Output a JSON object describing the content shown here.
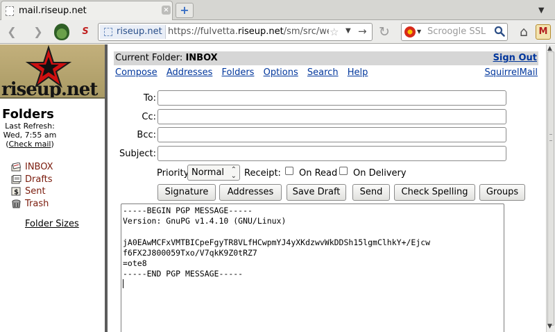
{
  "browser": {
    "tab_title": "mail.riseup.net",
    "url_site": "riseup.net",
    "url_prefix": "https://fulvetta.",
    "url_domain": "riseup.net",
    "url_path": "/sm/src/we",
    "search_placeholder": "Scroogle SSL",
    "icons": {
      "back": "back-arrow-icon",
      "forward": "forward-arrow-icon",
      "tor": "tor-onion-icon",
      "reload": "reload-icon",
      "home": "home-icon",
      "bookmark": "star-icon",
      "search": "magnifier-icon"
    }
  },
  "sidebar": {
    "logo_text": "riseup.net",
    "title": "Folders",
    "last_refresh_label": "Last Refresh:",
    "last_refresh_value": "Wed, 7:55 am",
    "check_mail_open": "(",
    "check_mail": "Check mail",
    "check_mail_close": ")",
    "folders": [
      {
        "label": "INBOX",
        "icon": "inbox-icon"
      },
      {
        "label": "Drafts",
        "icon": "drafts-icon"
      },
      {
        "label": "Sent",
        "icon": "sent-icon"
      },
      {
        "label": "Trash",
        "icon": "trash-icon"
      }
    ],
    "folder_sizes": "Folder Sizes"
  },
  "header": {
    "current_folder_label": "Current Folder:",
    "current_folder": "INBOX",
    "sign_out": "Sign Out",
    "menu": [
      "Compose",
      "Addresses",
      "Folders",
      "Options",
      "Search",
      "Help"
    ],
    "brand_link": "SquirrelMail"
  },
  "compose": {
    "to_label": "To:",
    "cc_label": "Cc:",
    "bcc_label": "Bcc:",
    "subject_label": "Subject:",
    "to": "",
    "cc": "",
    "bcc": "",
    "subject": "",
    "priority_label": "Priority",
    "priority_value": "Normal",
    "receipt_label": "Receipt:",
    "on_read_label": "On Read",
    "on_delivery_label": "On Delivery",
    "buttons": {
      "signature": "Signature",
      "addresses": "Addresses",
      "save_draft": "Save Draft",
      "send": "Send",
      "check_spelling": "Check Spelling",
      "groups": "Groups"
    },
    "body": "-----BEGIN PGP MESSAGE-----\nVersion: GnuPG v1.4.10 (GNU/Linux)\n\njA0EAwMCFxVMTBICpeFgyTR8VLfHCwpmYJ4yXKdzwvWkDDSh15lgmClhkY+/Ejcw\nf6FX2J800059Txo/V7qkK9Z0tRZ7\n=ote8\n-----END PGP MESSAGE-----\n"
  },
  "colors": {
    "link": "#00369c",
    "folder_link": "#7a1b0c",
    "header_bar": "#d6d6d6",
    "divider": "#5c5c5c"
  }
}
